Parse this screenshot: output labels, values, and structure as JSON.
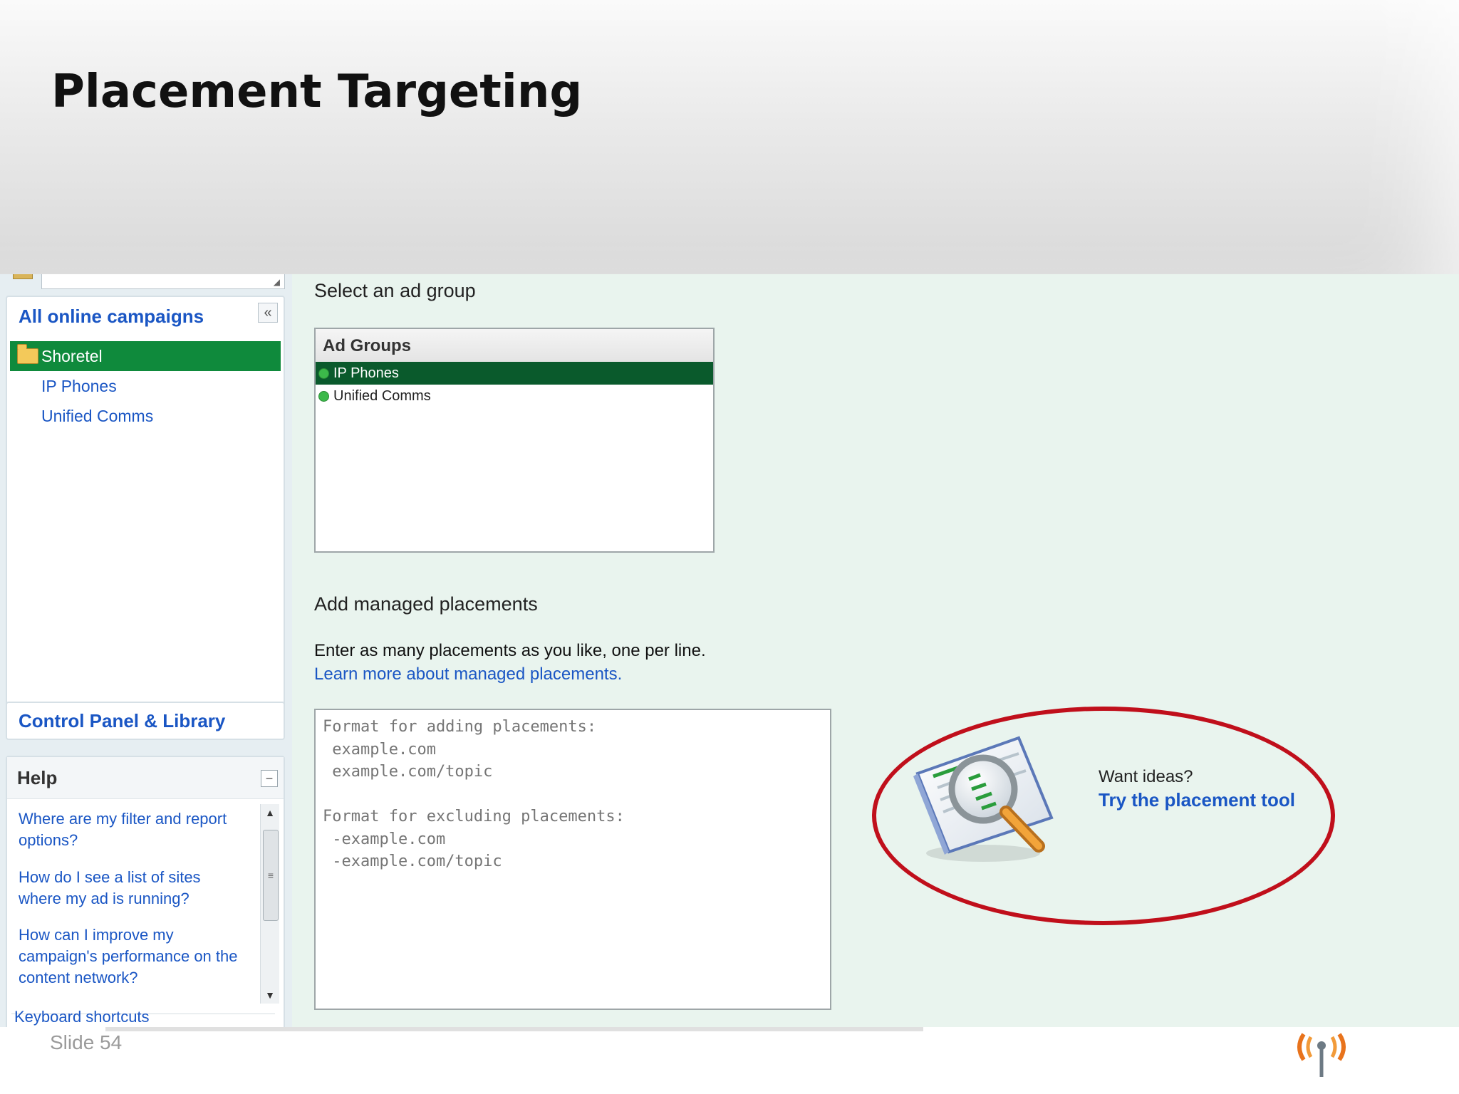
{
  "slide": {
    "title": "Placement Targeting",
    "footer": "Slide ",
    "slide_number": "54"
  },
  "sidebar": {
    "campaigns_title": "All online campaigns",
    "collapse_glyph": "«",
    "tree": {
      "selected": "Shoretel",
      "children": [
        "IP Phones",
        "Unified Comms"
      ]
    },
    "control_panel": "Control Panel & Library"
  },
  "help": {
    "title": "Help",
    "minimize_glyph": "−",
    "links": [
      "Where are my filter and report options?",
      "How do I see a list of sites where my ad is running?",
      "How can I improve my campaign's performance on the content network?"
    ],
    "keyboard_shortcuts": "Keyboard shortcuts"
  },
  "main": {
    "select_heading": "Select an ad group",
    "ad_groups": {
      "header": "Ad Groups",
      "rows": [
        {
          "name": "IP Phones",
          "selected": true
        },
        {
          "name": "Unified Comms",
          "selected": false
        }
      ]
    },
    "add_heading": "Add managed placements",
    "instructions": "Enter as many placements as you like, one per line.",
    "learn_more": "Learn more about managed placements.",
    "textarea_placeholder": "Format for adding placements:\n example.com\n example.com/topic\n\nFormat for excluding placements:\n -example.com\n -example.com/topic"
  },
  "ideas": {
    "prompt": "Want ideas?",
    "link": "Try the placement tool",
    "icon": "magnifier-report-icon"
  },
  "colors": {
    "accent_link": "#1a56c4",
    "tree_selected": "#0f8a3c",
    "adgroup_selected": "#0a5a2c",
    "status_active": "#3cb94a",
    "highlight_ellipse": "#c00f1b",
    "app_background": "#e9f4ee"
  }
}
